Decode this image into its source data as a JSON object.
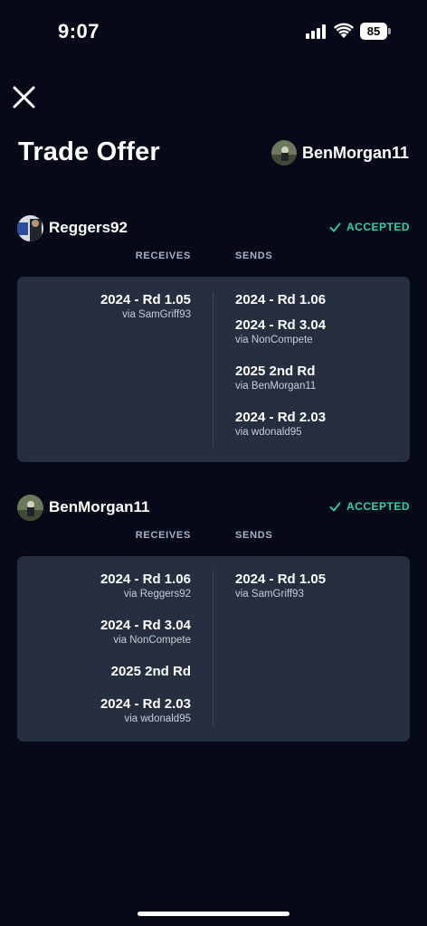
{
  "status_bar": {
    "time": "9:07",
    "battery": "85"
  },
  "page": {
    "title": "Trade Offer"
  },
  "header": {
    "username": "BenMorgan11"
  },
  "column_labels": {
    "receives": "RECEIVES",
    "sends": "SENDS"
  },
  "teams": [
    {
      "name": "Reggers92",
      "status": "ACCEPTED",
      "receives": [
        {
          "pick": "2024 - Rd 1.05",
          "via": "via SamGriff93"
        }
      ],
      "sends": [
        {
          "pick": "2024 - Rd 1.06",
          "via": ""
        },
        {
          "pick": "2024 - Rd 3.04",
          "via": "via NonCompete"
        },
        {
          "pick": "2025 2nd Rd",
          "via": "via BenMorgan11"
        },
        {
          "pick": "2024 - Rd 2.03",
          "via": "via wdonald95"
        }
      ]
    },
    {
      "name": "BenMorgan11",
      "status": "ACCEPTED",
      "receives": [
        {
          "pick": "2024 - Rd 1.06",
          "via": "via Reggers92"
        },
        {
          "pick": "2024 - Rd 3.04",
          "via": "via NonCompete"
        },
        {
          "pick": "2025 2nd Rd",
          "via": ""
        },
        {
          "pick": "2024 - Rd 2.03",
          "via": "via wdonald95"
        }
      ],
      "sends": [
        {
          "pick": "2024 - Rd 1.05",
          "via": "via SamGriff93"
        }
      ]
    }
  ],
  "colors": {
    "background": "#060a18",
    "card": "#262f40",
    "accent": "#2dd4a6"
  },
  "icons": {
    "close": "close-icon",
    "accepted": "checkmark-icon"
  }
}
